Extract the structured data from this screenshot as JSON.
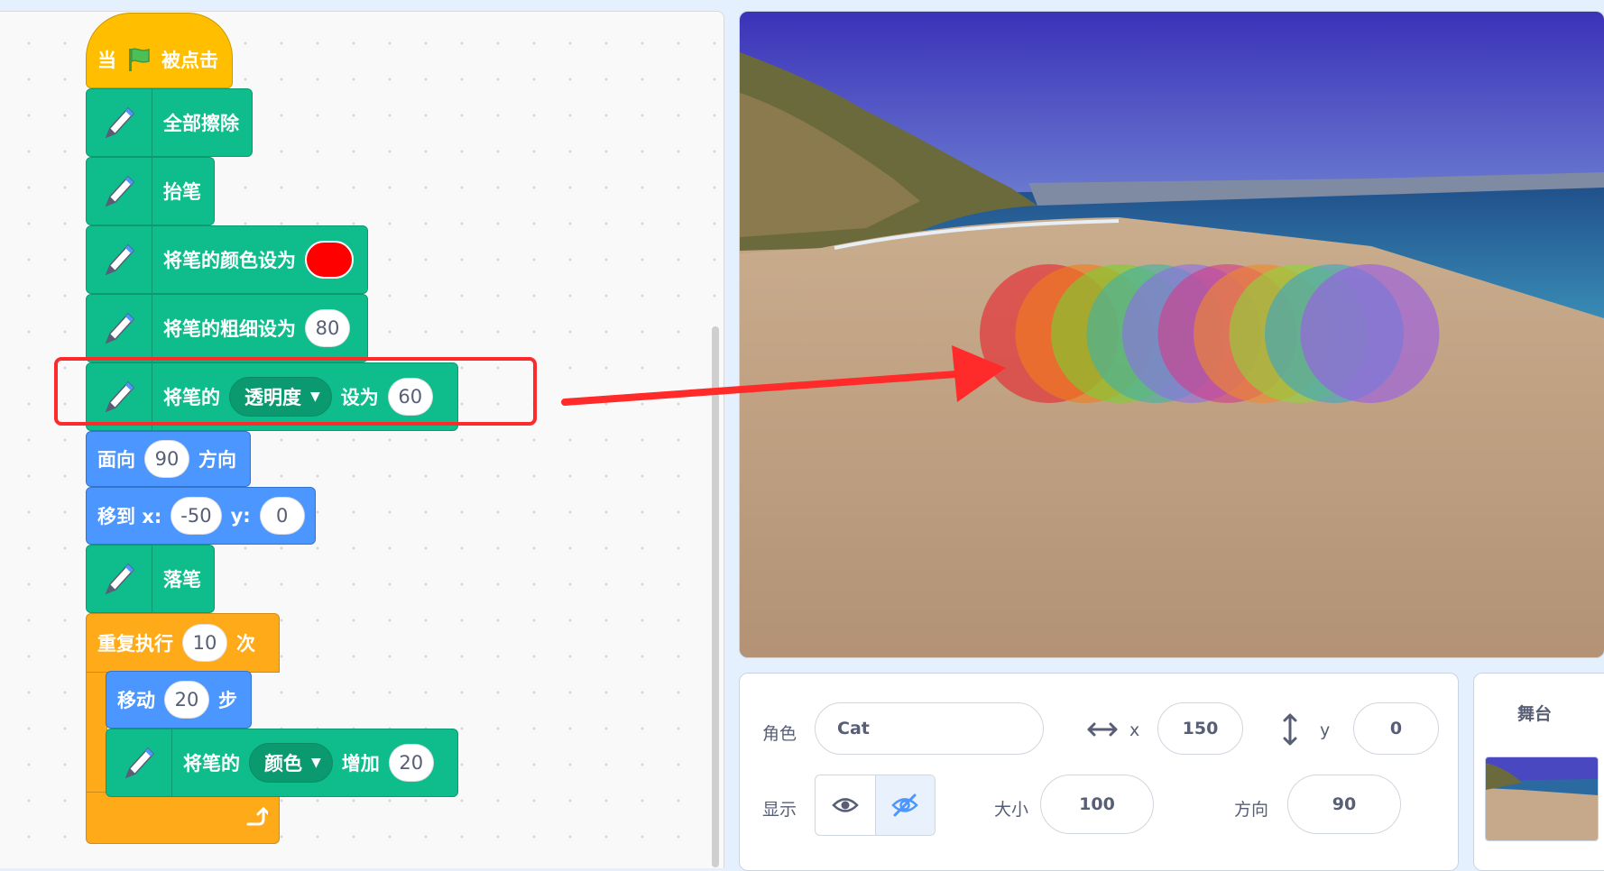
{
  "scripts": {
    "when_flag": {
      "pre": "当",
      "post": "被点击"
    },
    "clear_all": "全部擦除",
    "pen_up": "抬笔",
    "set_color": {
      "label": "将笔的颜色设为",
      "color": "#ff0000"
    },
    "set_size": {
      "label": "将笔的粗细设为",
      "value": "80"
    },
    "set_effect": {
      "pre": "将笔的",
      "option": "透明度",
      "mid": "设为",
      "value": "60"
    },
    "point_direction": {
      "pre": "面向",
      "value": "90",
      "post": "方向"
    },
    "goto_xy": {
      "x_label": "移到 x:",
      "x": "-50",
      "y_label": "y:",
      "y": "0"
    },
    "pen_down": "落笔",
    "repeat": {
      "pre": "重复执行",
      "value": "10",
      "post": "次"
    },
    "move": {
      "pre": "移动",
      "value": "20",
      "post": "步"
    },
    "change_color": {
      "pre": "将笔的",
      "option": "颜色",
      "mid": "增加",
      "value": "20"
    }
  },
  "sprite_info": {
    "sprite_label": "角色",
    "sprite_name": "Cat",
    "x_label": "x",
    "x_value": "150",
    "y_label": "y",
    "y_value": "0",
    "show_label": "显示",
    "size_label": "大小",
    "size_value": "100",
    "direction_label": "方向",
    "direction_value": "90"
  },
  "stage_panel": {
    "label": "舞台"
  },
  "colors": {
    "pen": "#0fbd8c",
    "motion": "#4c97ff",
    "control": "#ffab19",
    "events": "#ffbf00",
    "highlight": "#ff2a2a",
    "pen_circles": [
      "#e8232f",
      "#f07d1b",
      "#7ccf2e",
      "#3fb3a5",
      "#8b6fe6",
      "#d23c8a",
      "#f0872c",
      "#8fd33a",
      "#3aa7c2",
      "#9b5be8"
    ]
  }
}
